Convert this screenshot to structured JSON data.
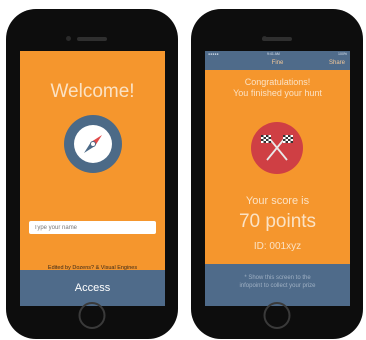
{
  "welcome_screen": {
    "title": "Welcome!",
    "icon": "compass-icon",
    "name_input": {
      "placeholder": "Type your name",
      "value": ""
    },
    "edited_by": "Edited by Dozens? & Visual Engines",
    "access_button": "Access"
  },
  "result_screen": {
    "status_bar": {
      "carrier": "●●●●● ",
      "time": "9:41 AM",
      "battery": "100%"
    },
    "nav": {
      "title": "Fine",
      "share": "Share"
    },
    "congrats_line1": "Congratulations!",
    "congrats_line2": "You finished your hunt",
    "icon": "checkered-flags-icon",
    "score_label": "Your score is",
    "score_value": "70 points",
    "id_line": "ID: 001xyz",
    "info_line1": "* Show this screen to the",
    "info_line2": "infopoint to collect your prize"
  },
  "colors": {
    "orange": "#f5962d",
    "navy": "#4f6b8a",
    "red_badge": "#cf3f44",
    "text_light": "#fbe2c4"
  }
}
